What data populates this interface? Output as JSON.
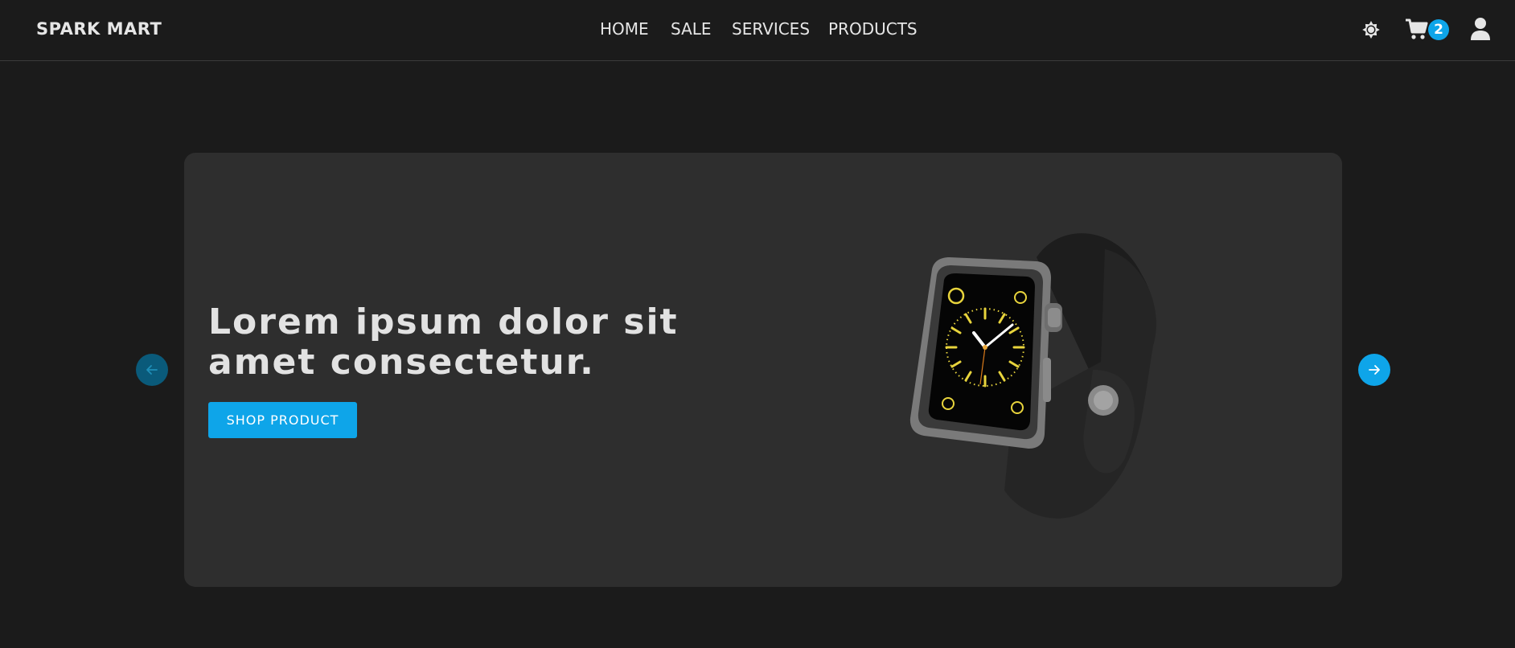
{
  "brand": {
    "name": "SPARK MART"
  },
  "nav": {
    "items": [
      {
        "label": "HOME"
      },
      {
        "label": "SALE"
      },
      {
        "label": "SERVICES"
      },
      {
        "label": "PRODUCTS"
      }
    ]
  },
  "header_icons": {
    "theme_toggle_icon": "sun-icon",
    "cart_icon": "cart-icon",
    "cart_count": "2",
    "user_icon": "user-icon"
  },
  "hero": {
    "title": "Lorem ipsum dolor sit amet consectetur.",
    "cta_label": "SHOP PRODUCT",
    "image": "smartwatch-product-image"
  },
  "carousel": {
    "prev_icon": "arrow-left-icon",
    "next_icon": "arrow-right-icon"
  },
  "colors": {
    "background": "#1b1b1b",
    "card": "#2e2e2e",
    "accent": "#0ea5e9",
    "text": "#e6e6e6"
  }
}
